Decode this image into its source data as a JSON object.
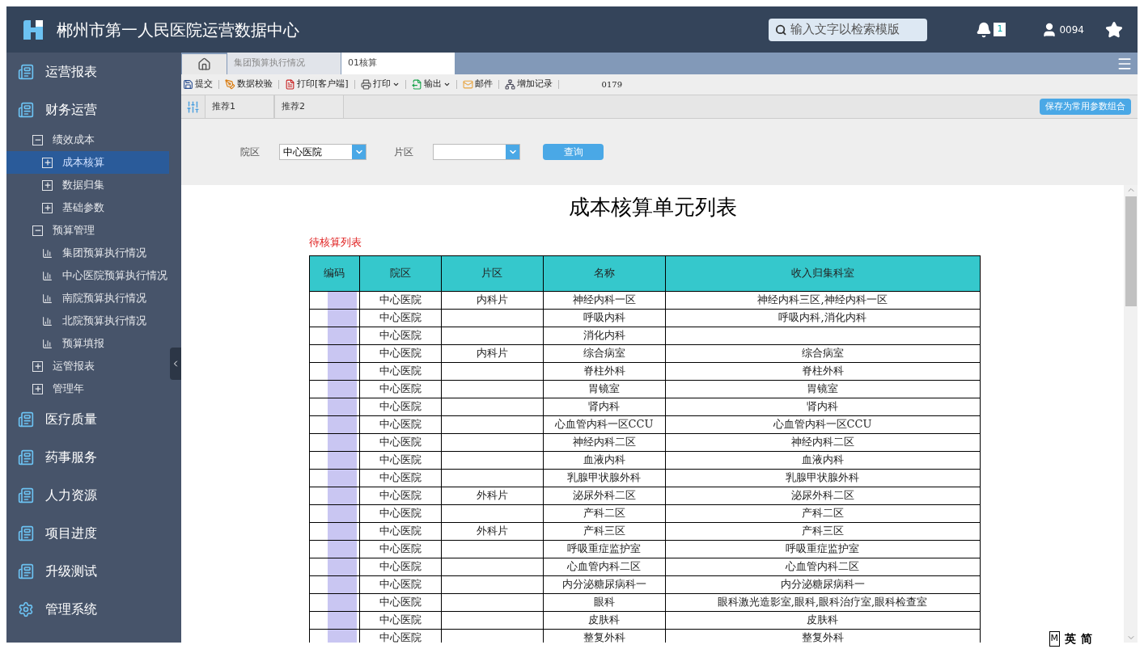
{
  "header": {
    "title": "郴州市第一人民医院运营数据中心",
    "search": {
      "placeholder": "输入文字以检索模版"
    },
    "notifications": "1",
    "user": "0094"
  },
  "sidebar": [
    {
      "label": "运营报表",
      "kind": "module"
    },
    {
      "label": "财务运营",
      "kind": "module",
      "children": [
        {
          "label": "绩效成本",
          "expanded": true,
          "selected": false,
          "children": [
            {
              "label": "成本核算",
              "kind": "folder",
              "selected": true
            },
            {
              "label": "数据归集",
              "kind": "folder",
              "selected": false
            },
            {
              "label": "基础参数",
              "kind": "folder",
              "selected": false
            }
          ]
        },
        {
          "label": "预算管理",
          "expanded": true,
          "selected": false,
          "children": [
            {
              "label": "集团预算执行情况",
              "kind": "report",
              "selected": false
            },
            {
              "label": "中心医院预算执行情况",
              "kind": "report",
              "selected": false
            },
            {
              "label": "南院预算执行情况",
              "kind": "report",
              "selected": false
            },
            {
              "label": "北院预算执行情况",
              "kind": "report",
              "selected": false
            },
            {
              "label": "预算填报",
              "kind": "report",
              "selected": false
            }
          ]
        },
        {
          "label": "运管报表",
          "expanded": false,
          "selected": false
        },
        {
          "label": "管理年",
          "expanded": false,
          "selected": false
        }
      ]
    },
    {
      "label": "医疗质量",
      "kind": "module"
    },
    {
      "label": "药事服务",
      "kind": "module"
    },
    {
      "label": "人力资源",
      "kind": "module"
    },
    {
      "label": "项目进度",
      "kind": "module"
    },
    {
      "label": "升级测试",
      "kind": "module"
    },
    {
      "label": "管理系统",
      "kind": "system"
    }
  ],
  "tabs": [
    {
      "label": "集团预算执行情况",
      "selected": false
    },
    {
      "label": "01核算",
      "selected": true
    }
  ],
  "toolbar": [
    {
      "label": "提交",
      "kind": "save",
      "dropdown": false
    },
    {
      "label": "数据校验",
      "kind": "check",
      "dropdown": false
    },
    {
      "label": "打印[客户端]",
      "kind": "pdf",
      "dropdown": false
    },
    {
      "label": "打印",
      "kind": "print",
      "dropdown": true
    },
    {
      "label": "输出",
      "kind": "export",
      "dropdown": true
    },
    {
      "label": "邮件",
      "kind": "mail",
      "dropdown": false
    },
    {
      "label": "增加记录",
      "kind": "add",
      "dropdown": false
    }
  ],
  "toolbar_code": "0179",
  "presets": [
    {
      "label": "推荐1",
      "selected": false
    },
    {
      "label": "推荐2",
      "selected": false
    }
  ],
  "save_preset": "保存为常用参数组合",
  "filters": [
    {
      "label": "院区",
      "value": "中心医院"
    },
    {
      "label": "片区"
    }
  ],
  "query_button": "查询",
  "report": {
    "title": "成本核算单元列表",
    "subtitle": "待核算列表",
    "columns": [
      "编码",
      "院区",
      "片区",
      "名称",
      "收入归集科室"
    ],
    "rows": [
      [
        "",
        "中心医院",
        "内科片",
        "神经内科一区",
        "神经内科三区,神经内科一区"
      ],
      [
        "",
        "中心医院",
        "",
        "呼吸内科",
        "呼吸内科,消化内科"
      ],
      [
        "",
        "中心医院",
        "",
        "消化内科",
        ""
      ],
      [
        "",
        "中心医院",
        "内科片",
        "综合病室",
        "综合病室"
      ],
      [
        "",
        "中心医院",
        "",
        "脊柱外科",
        "脊柱外科"
      ],
      [
        "",
        "中心医院",
        "",
        "胃镜室",
        "胃镜室"
      ],
      [
        "",
        "中心医院",
        "",
        "肾内科",
        "肾内科"
      ],
      [
        "",
        "中心医院",
        "",
        "心血管内科一区CCU",
        "心血管内科一区CCU"
      ],
      [
        "",
        "中心医院",
        "",
        "神经内科二区",
        "神经内科二区"
      ],
      [
        "",
        "中心医院",
        "",
        "血液内科",
        "血液内科"
      ],
      [
        "",
        "中心医院",
        "",
        "乳腺甲状腺外科",
        "乳腺甲状腺外科"
      ],
      [
        "",
        "中心医院",
        "外科片",
        "泌尿外科二区",
        "泌尿外科二区"
      ],
      [
        "",
        "中心医院",
        "",
        "产科二区",
        "产科二区"
      ],
      [
        "",
        "中心医院",
        "外科片",
        "产科三区",
        "产科三区"
      ],
      [
        "",
        "中心医院",
        "",
        "呼吸重症监护室",
        "呼吸重症监护室"
      ],
      [
        "",
        "中心医院",
        "",
        "心血管内科二区",
        "心血管内科二区"
      ],
      [
        "",
        "中心医院",
        "",
        "内分泌糖尿病科一",
        "内分泌糖尿病科一"
      ],
      [
        "",
        "中心医院",
        "",
        "眼科",
        "眼科激光造影室,眼科,眼科治疗室,眼科检查室"
      ],
      [
        "",
        "中心医院",
        "",
        "皮肤科",
        "皮肤科"
      ],
      [
        "",
        "中心医院",
        "",
        "整复外科",
        "整复外科"
      ]
    ]
  },
  "ime_bar": [
    "M",
    "英",
    "简"
  ]
}
